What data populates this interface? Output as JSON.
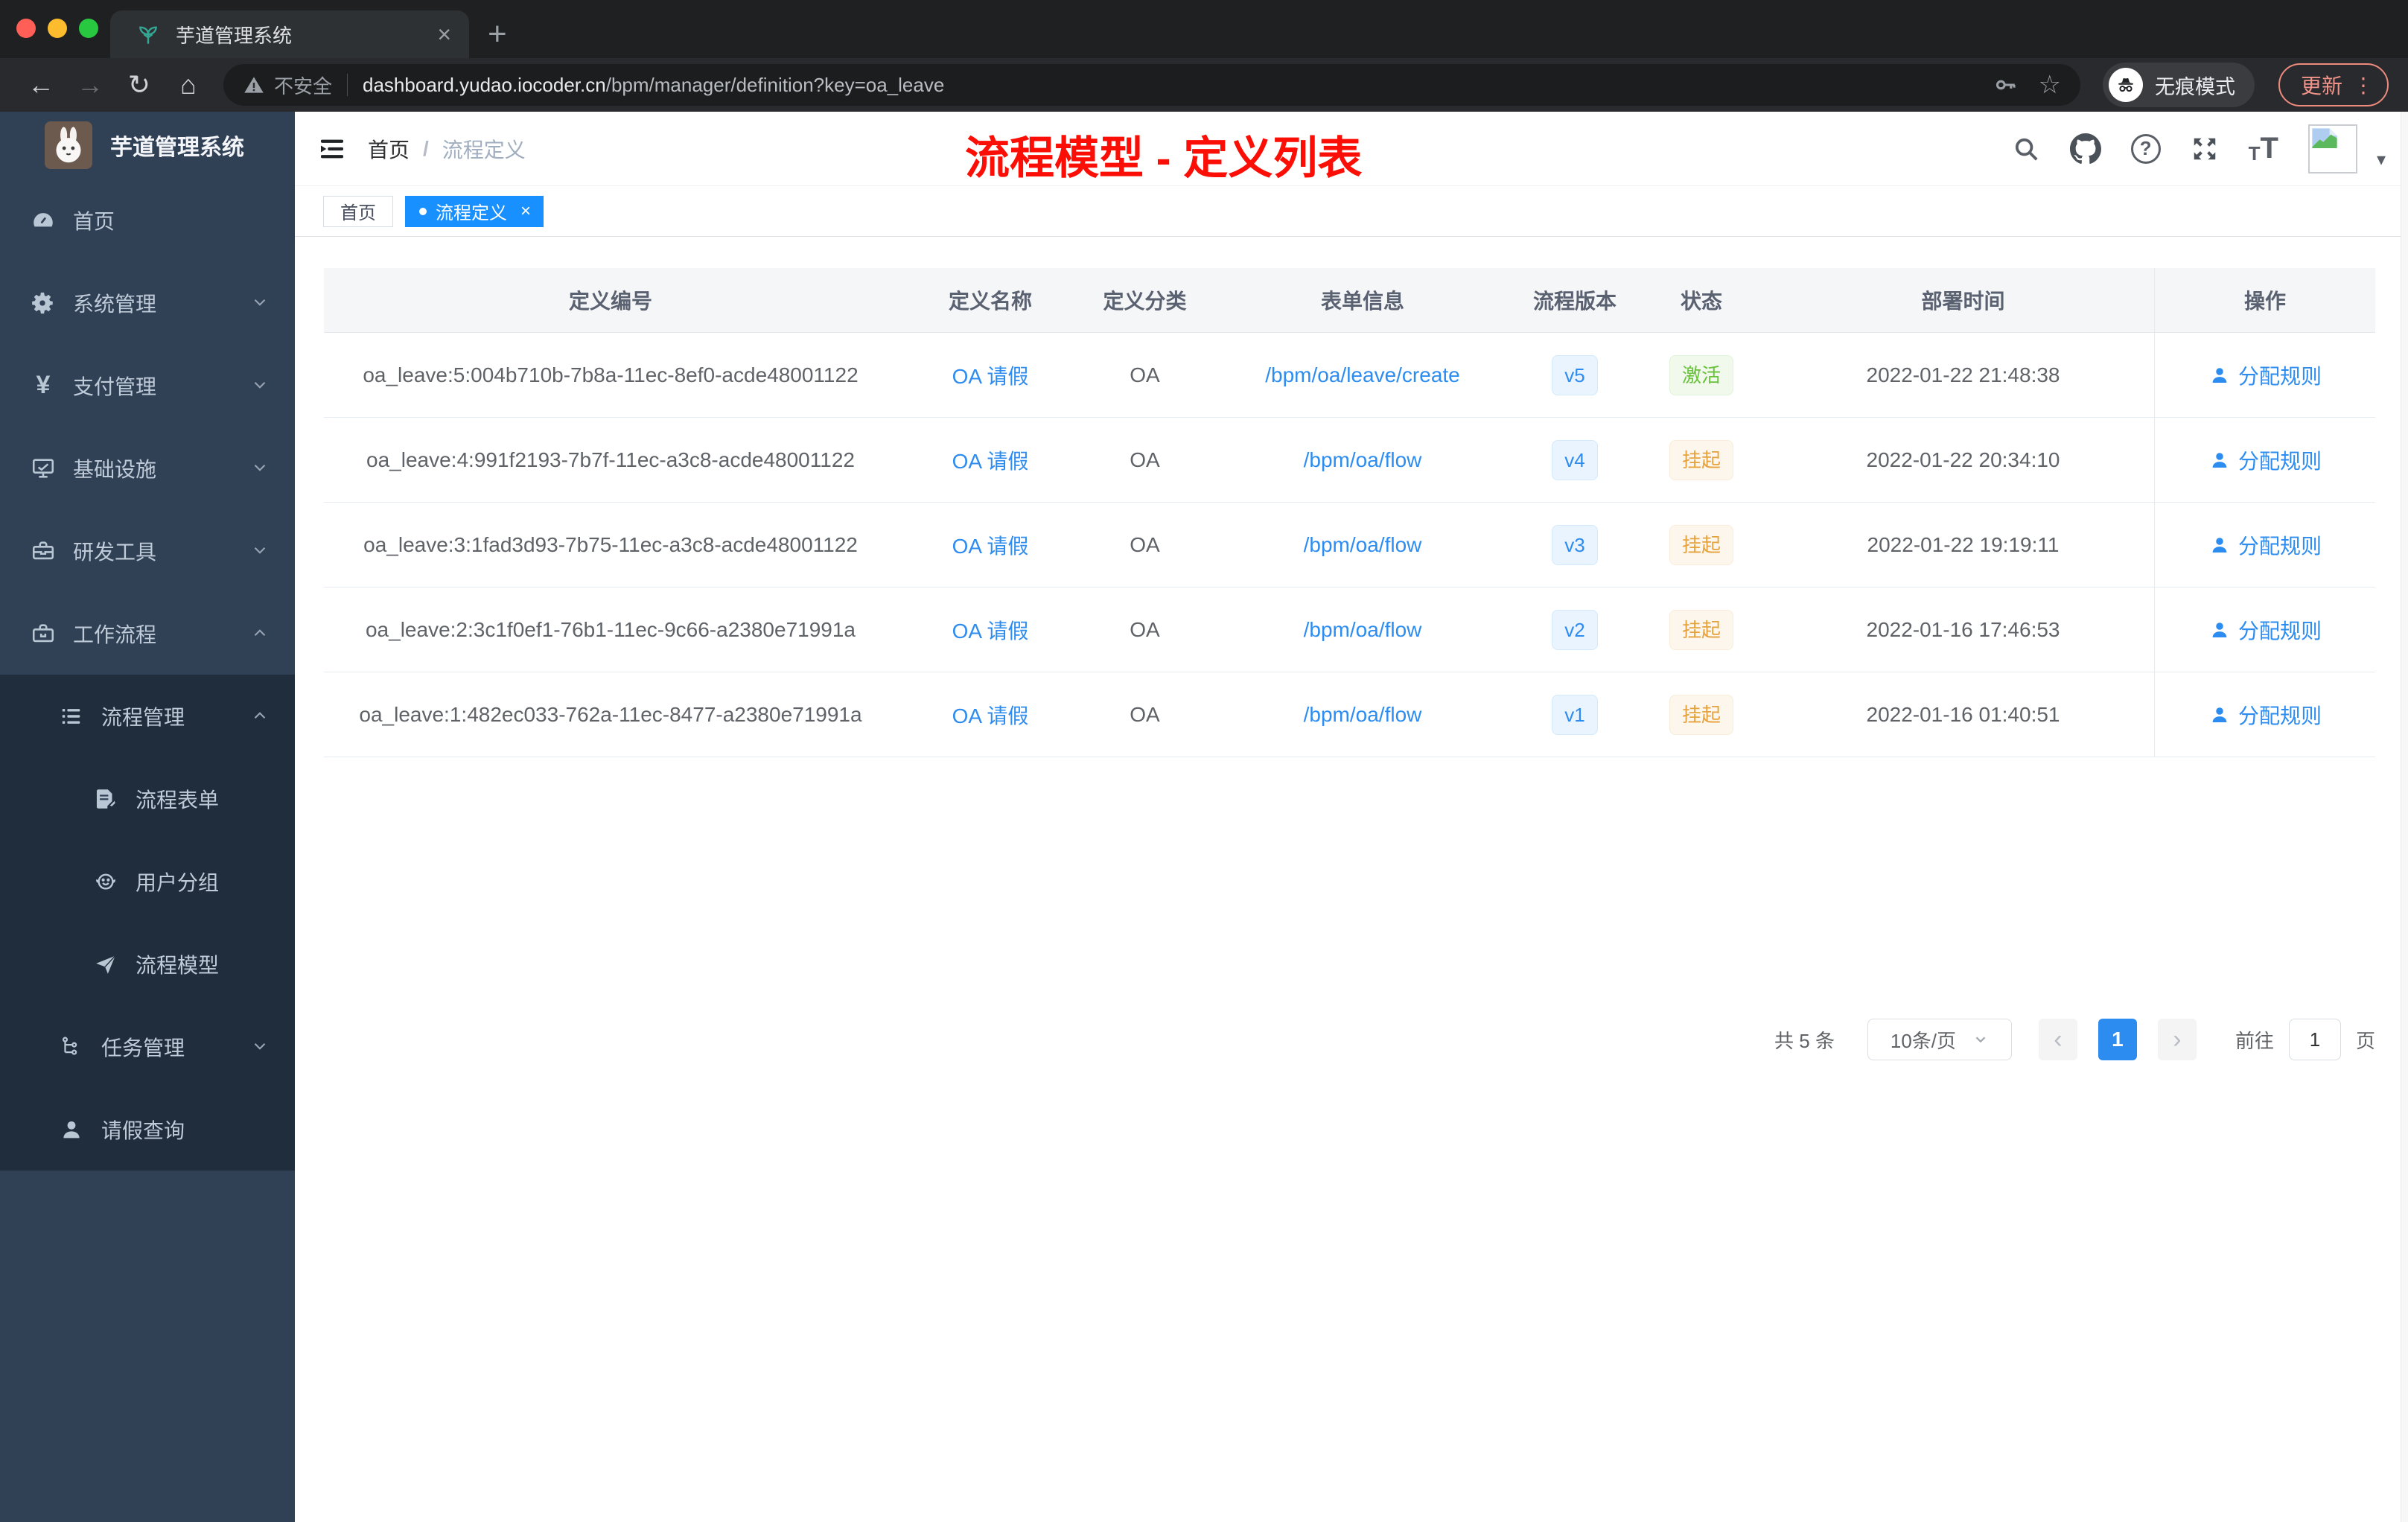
{
  "colors": {
    "primary_blue": "#2d8cf0",
    "tag_active_blue": "#1890ff",
    "success_green": "#67c23a",
    "warning_orange": "#e6a23c",
    "annotation_red": "#fb0e05",
    "sidebar_bg": "#304156",
    "submenu_bg": "#1f2d3d"
  },
  "icons": {
    "back": "←",
    "forward": "→",
    "reload": "↻",
    "home": "⌂",
    "star": "☆",
    "plus": "+",
    "close": "×",
    "dots": "⋮",
    "caret_down": "▾",
    "question": "?",
    "font_small": "T",
    "font_big": "T"
  },
  "browser": {
    "tab_title": "芋道管理系统",
    "security_label": "不安全",
    "url_domain": "dashboard.yudao.iocoder.cn",
    "url_path": "/bpm/manager/definition?key=oa_leave",
    "incognito_label": "无痕模式",
    "update_label": "更新"
  },
  "sidebar": {
    "logo_title": "芋道管理系统",
    "items": [
      {
        "label": "首页"
      },
      {
        "label": "系统管理"
      },
      {
        "label": "支付管理"
      },
      {
        "label": "基础设施"
      },
      {
        "label": "研发工具"
      },
      {
        "label": "工作流程"
      },
      {
        "label": "流程管理"
      },
      {
        "label": "流程表单"
      },
      {
        "label": "用户分组"
      },
      {
        "label": "流程模型"
      },
      {
        "label": "任务管理"
      },
      {
        "label": "请假查询"
      }
    ]
  },
  "navbar": {
    "breadcrumb_home": "首页",
    "breadcrumb_sep": "/",
    "breadcrumb_current": "流程定义",
    "annotation": "流程模型 - 定义列表"
  },
  "tags": {
    "home": "首页",
    "active": "流程定义"
  },
  "table": {
    "headers": [
      "定义编号",
      "定义名称",
      "定义分类",
      "表单信息",
      "流程版本",
      "状态",
      "部署时间",
      "操作"
    ],
    "action_label": "分配规则",
    "rows": [
      {
        "id": "oa_leave:5:004b710b-7b8a-11ec-8ef0-acde48001122",
        "name": "OA 请假",
        "category": "OA",
        "form": "/bpm/oa/leave/create",
        "version": "v5",
        "status": "激活",
        "time": "2022-01-22 21:48:38"
      },
      {
        "id": "oa_leave:4:991f2193-7b7f-11ec-a3c8-acde48001122",
        "name": "OA 请假",
        "category": "OA",
        "form": "/bpm/oa/flow",
        "version": "v4",
        "status": "挂起",
        "time": "2022-01-22 20:34:10"
      },
      {
        "id": "oa_leave:3:1fad3d93-7b75-11ec-a3c8-acde48001122",
        "name": "OA 请假",
        "category": "OA",
        "form": "/bpm/oa/flow",
        "version": "v3",
        "status": "挂起",
        "time": "2022-01-22 19:19:11"
      },
      {
        "id": "oa_leave:2:3c1f0ef1-76b1-11ec-9c66-a2380e71991a",
        "name": "OA 请假",
        "category": "OA",
        "form": "/bpm/oa/flow",
        "version": "v2",
        "status": "挂起",
        "time": "2022-01-16 17:46:53"
      },
      {
        "id": "oa_leave:1:482ec033-762a-11ec-8477-a2380e71991a",
        "name": "OA 请假",
        "category": "OA",
        "form": "/bpm/oa/flow",
        "version": "v1",
        "status": "挂起",
        "time": "2022-01-16 01:40:51"
      }
    ]
  },
  "pagination": {
    "total": "共 5 条",
    "page_size": "10条/页",
    "prev": "‹",
    "page": "1",
    "next": "›",
    "goto_label": "前往",
    "goto_value": "1",
    "unit": "页"
  }
}
